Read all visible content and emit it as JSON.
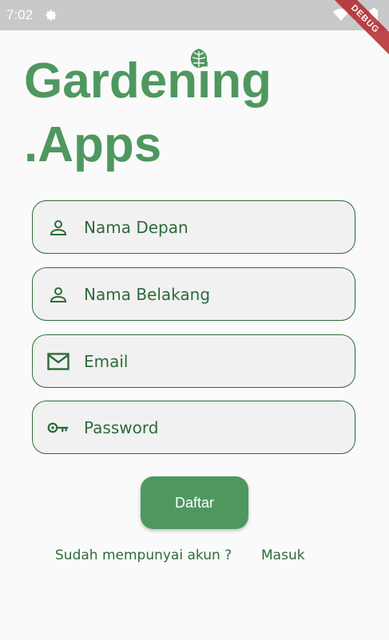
{
  "status_bar": {
    "time": "7:02",
    "icons": [
      "settings-icon",
      "wifi-icon",
      "signal-icon",
      "battery-icon"
    ],
    "debug_label": "DEBUG"
  },
  "logo": {
    "line1": "Gardening",
    "line2": ".Apps",
    "leaf_icon": "leaf-icon",
    "color": "#4e9860"
  },
  "form": {
    "first_name": {
      "placeholder": "Nama Depan",
      "value": "",
      "icon": "person-icon"
    },
    "last_name": {
      "placeholder": "Nama Belakang",
      "value": "",
      "icon": "person-icon"
    },
    "email": {
      "placeholder": "Email",
      "value": "",
      "icon": "mail-icon"
    },
    "password": {
      "placeholder": "Password",
      "value": "",
      "icon": "key-icon"
    }
  },
  "actions": {
    "register_label": "Daftar",
    "have_account_text": "Sudah mempunyai akun ?",
    "login_label": "Masuk"
  },
  "colors": {
    "primary": "#4e9860",
    "border": "#2e6b3a",
    "field_bg": "#f1f1f1",
    "page_bg": "#fafafa",
    "debug_ribbon": "#b4272c"
  }
}
